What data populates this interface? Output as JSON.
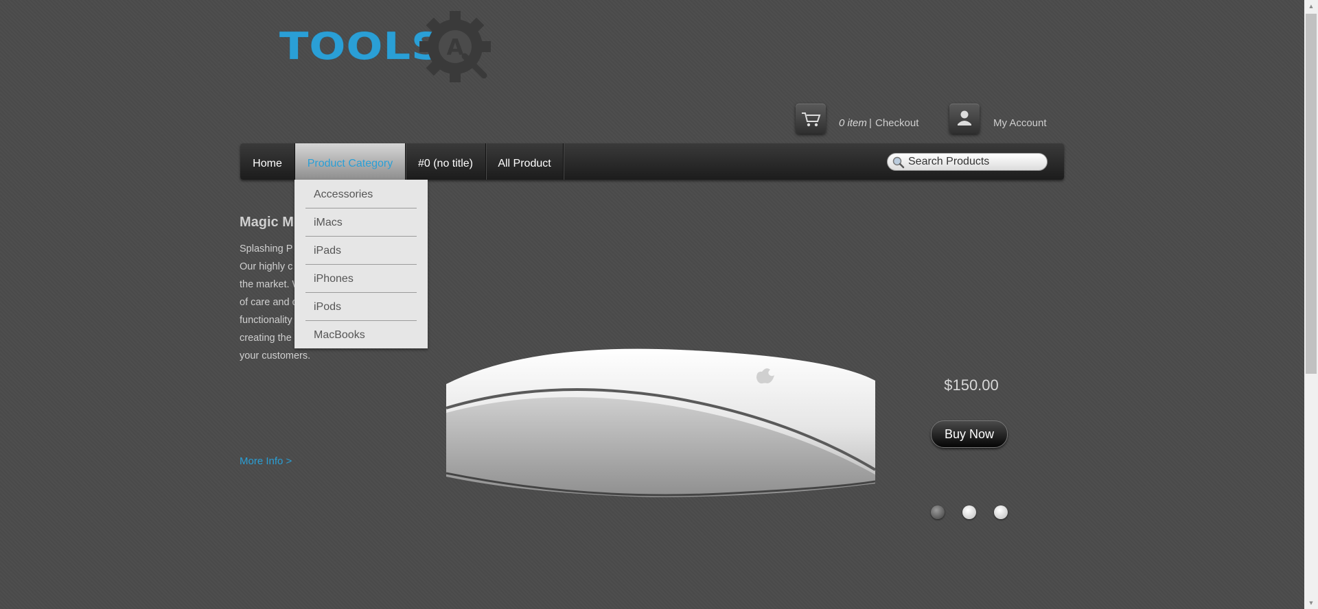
{
  "brand": {
    "logo_text": "TOOLS",
    "logo_badge": "A",
    "accent_color": "#2a9fd6"
  },
  "header": {
    "cart_count": "0 item",
    "separator": "|",
    "checkout_label": "Checkout",
    "account_label": "My Account"
  },
  "nav": {
    "items": [
      {
        "label": "Home"
      },
      {
        "label": "Product Category",
        "active": true
      },
      {
        "label": "#0 (no title)"
      },
      {
        "label": "All Product"
      }
    ],
    "search_placeholder": "Search Products"
  },
  "dropdown": {
    "items": [
      "Accessories",
      "iMacs",
      "iPads",
      "iPhones",
      "iPods",
      "MacBooks"
    ]
  },
  "feature": {
    "title": "Magic M",
    "body": "Splashing P  commerce th  commerce s  Our highly c  commerce th  technology i  the market. We put an amazing amount of care and detail into the design and functionality to ensure that we're creating the best user experience for your customers.",
    "more_info": "More Info >",
    "price": "$150.00",
    "buy_label": "Buy Now",
    "slides": {
      "count": 3,
      "active": 1
    }
  },
  "icons": {
    "cart": "cart-icon",
    "account": "user-icon",
    "search": "search-icon",
    "gear": "gear-icon"
  }
}
